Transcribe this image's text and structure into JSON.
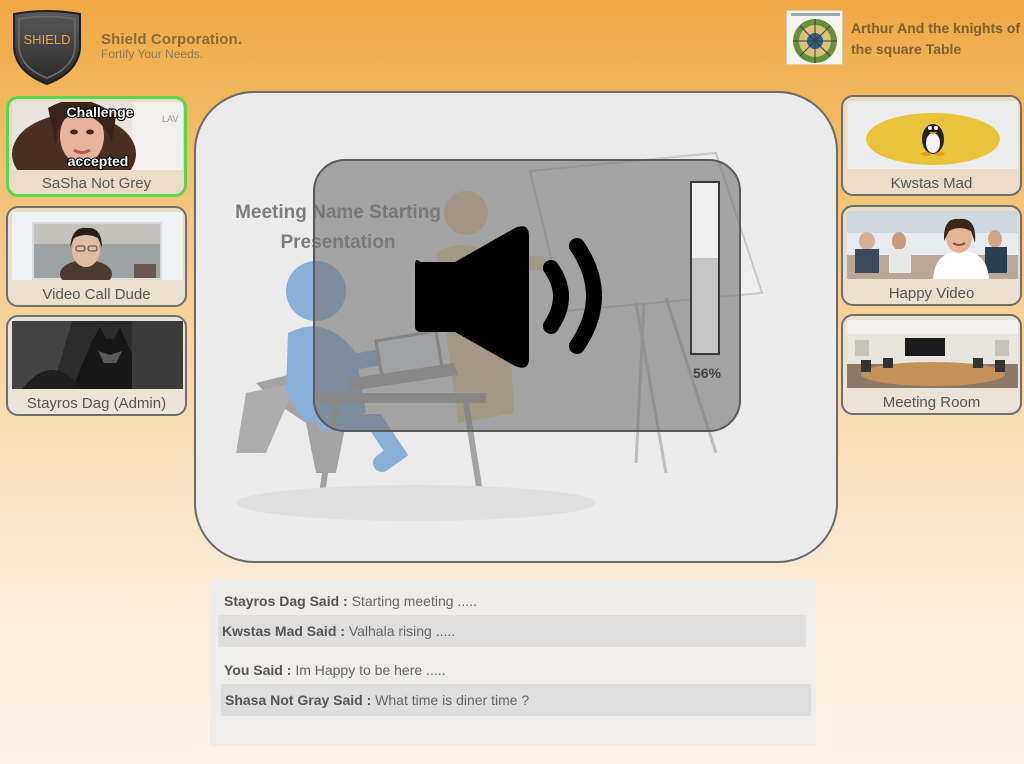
{
  "header": {
    "logo_text": "SHIELD",
    "company": "Shield Corporation.",
    "tagline": "Fortify Your Needs.",
    "room_title": "Arthur And the knights of the square Table"
  },
  "participants_left": [
    {
      "name": "SaSha Not Grey",
      "active": true,
      "overlay_top": "Challenge",
      "overlay_bottom": "accepted"
    },
    {
      "name": "Video Call Dude",
      "active": false
    },
    {
      "name": "Stayros Dag (Admin)",
      "active": false
    }
  ],
  "participants_right": [
    {
      "name": "Kwstas Mad"
    },
    {
      "name": "Happy Video"
    },
    {
      "name": "Meeting Room"
    }
  ],
  "stage": {
    "title": "Meeting Name Starting Presentation"
  },
  "volume": {
    "level": 0.56,
    "label": "56%"
  },
  "chat": [
    {
      "who": "Stayros Dag Said :",
      "text": "Starting meeting ....."
    },
    {
      "who": "Kwstas Mad Said :",
      "text": "Valhala rising ....."
    },
    {
      "who": "You Said :",
      "text": "Im Happy to be here ....."
    },
    {
      "who": "Shasa Not Gray Said :",
      "text": "What time is diner time ?"
    }
  ],
  "colors": {
    "accent_active": "#5ad64c",
    "brand_text": "#8a6a3a",
    "shield_text": "#e6a64a"
  }
}
